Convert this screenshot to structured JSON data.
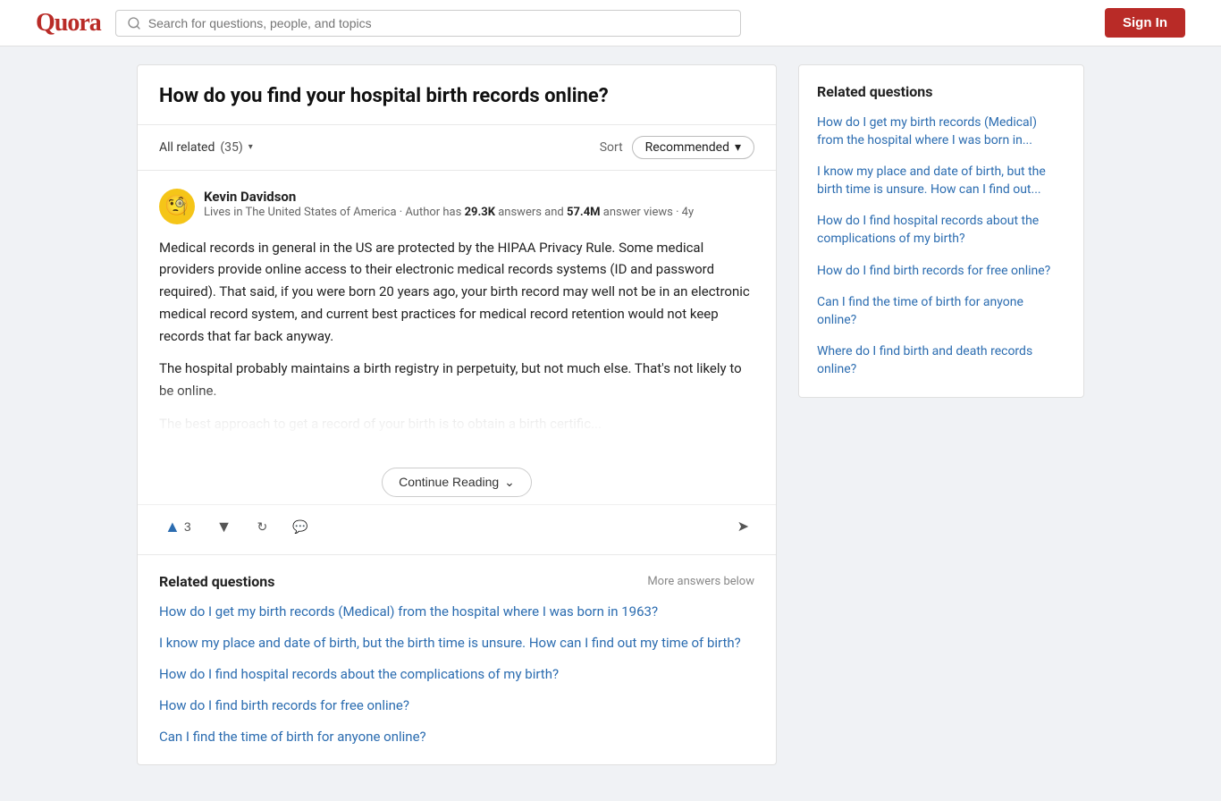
{
  "header": {
    "logo": "Quora",
    "search_placeholder": "Search for questions, people, and topics",
    "signin_label": "Sign In"
  },
  "question": {
    "title": "How do you find your hospital birth records online?",
    "filter": {
      "all_related_label": "All related",
      "count": "(35)",
      "sort_label": "Sort",
      "sort_value": "Recommended"
    }
  },
  "answer": {
    "author_name": "Kevin Davidson",
    "author_emoji": "🧐",
    "author_meta_prefix": "Lives in The United States of America · Author has ",
    "answers_count": "29.3K",
    "answers_label": " answers and ",
    "views_count": "57.4M",
    "views_label": " answer views · 4y",
    "text_p1": "Medical records in general in the US are protected by the HIPAA Privacy Rule. Some medical providers provide online access to their electronic medical records systems (ID and password required). That said, if you were born 20 years ago, your birth record may well not be in an electronic medical record system, and current best practices for medical record retention would not keep records that far back anyway.",
    "text_p2": "The hospital probably maintains a birth registry in perpetuity, but not much else. That's not likely to be online.",
    "text_p3_faded": "The best approach to get a record of your birth is to obtain a birth certific...",
    "upvote_count": "3",
    "continue_reading_label": "Continue Reading",
    "chevron_down": "⌄"
  },
  "related_in_card": {
    "title": "Related questions",
    "more_answers": "More answers below",
    "links": [
      "How do I get my birth records (Medical) from the hospital where I was born in 1963?",
      "I know my place and date of birth, but the birth time is unsure. How can I find out my time of birth?",
      "How do I find hospital records about the complications of my birth?",
      "How do I find birth records for free online?",
      "Can I find the time of birth for anyone online?"
    ]
  },
  "sidebar": {
    "title": "Related questions",
    "links": [
      "How do I get my birth records (Medical) from the hospital where I was born in...",
      "I know my place and date of birth, but the birth time is unsure. How can I find out...",
      "How do I find hospital records about the complications of my birth?",
      "How do I find birth records for free online?",
      "Can I find the time of birth for anyone online?",
      "Where do I find birth and death records online?"
    ]
  }
}
